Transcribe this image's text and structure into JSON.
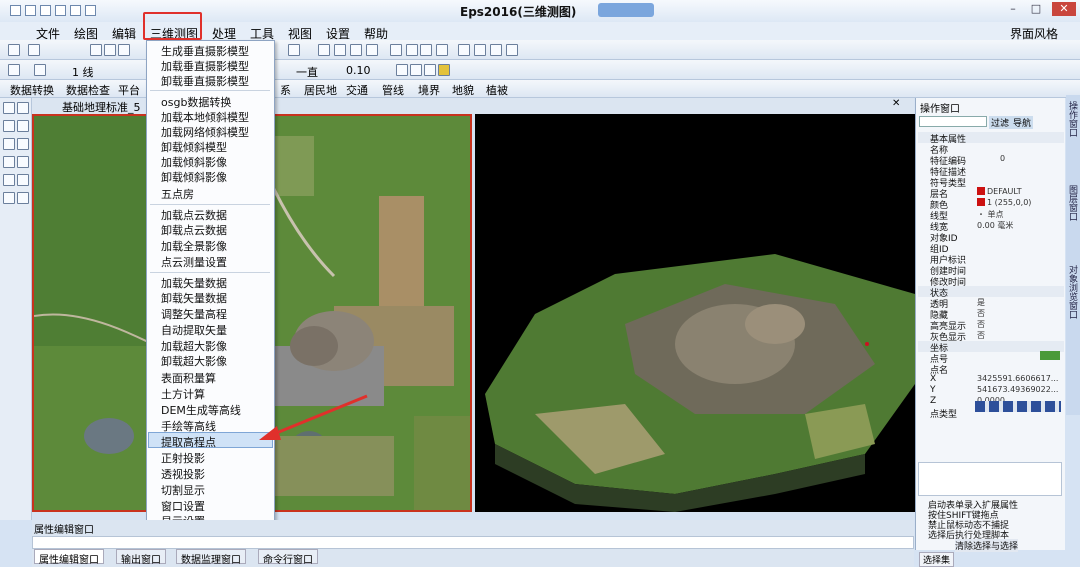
{
  "window": {
    "title": "Eps2016(三维测图)"
  },
  "menubar": {
    "items": [
      "文件",
      "绘图",
      "编辑",
      "三维测图",
      "处理",
      "工具",
      "视图",
      "设置",
      "帮助"
    ],
    "right": "界面风格"
  },
  "toolbar3": {
    "layer": "1 线",
    "width": "0.10",
    "zhi": "一直"
  },
  "toolbar4": {
    "items": [
      "数据转换",
      "数据检查",
      "平台",
      "系",
      "居民地",
      "交通",
      "管线",
      "境界",
      "地貌",
      "植被"
    ]
  },
  "doc_tab": "基础地理标准_5",
  "dropdown": {
    "items": [
      "生成垂直摄影模型",
      "加载垂直摄影模型",
      "卸载垂直摄影模型",
      "osgb数据转换",
      "加载本地倾斜模型",
      "加载网络倾斜模型",
      "卸载倾斜模型",
      "加载倾斜影像",
      "卸载倾斜影像",
      "五点房",
      "加载点云数据",
      "卸载点云数据",
      "加载全景影像",
      "点云测量设置",
      "加载矢量数据",
      "卸载矢量数据",
      "调整矢量高程",
      "自动提取矢量",
      "加载超大影像",
      "卸载超大影像",
      "表面积量算",
      "土方计算",
      "DEM生成等高线",
      "手绘等高线",
      "提取高程点",
      "正射投影",
      "透视投影",
      "切割显示",
      "窗口设置",
      "显示设置"
    ],
    "highlighted": "提取高程点"
  },
  "panel": {
    "title": "操作窗口",
    "buttons": [
      "过滤",
      "导航"
    ],
    "group1": "基本属性",
    "rows1": [
      [
        "名称",
        ""
      ],
      [
        "特征编码",
        "0"
      ],
      [
        "特征描述",
        ""
      ],
      [
        "符号类型",
        ""
      ],
      [
        "层名",
        "DEFAULT"
      ],
      [
        "颜色",
        "1 (255,0,0)"
      ],
      [
        "线型",
        "・ 单点"
      ],
      [
        "线宽",
        "0.00 毫米"
      ],
      [
        "对象ID",
        ""
      ],
      [
        "组ID",
        ""
      ],
      [
        "用户标识",
        ""
      ],
      [
        "创建时间",
        ""
      ],
      [
        "修改时间",
        ""
      ]
    ],
    "group2": "状态",
    "rows2": [
      [
        "透明",
        "是"
      ],
      [
        "隐藏",
        "否"
      ],
      [
        "高亮显示",
        "否"
      ],
      [
        "灰色显示",
        "否"
      ]
    ],
    "group3": "坐标",
    "rows3": [
      [
        "点号",
        ""
      ],
      [
        "点名",
        ""
      ],
      [
        "X",
        "3425591.6606617..."
      ],
      [
        "Y",
        "541673.49369022..."
      ],
      [
        "Z",
        "0.0000"
      ],
      [
        "点类型",
        ""
      ]
    ],
    "checks": [
      "启动表单录入扩展属性",
      "按住SHIFT键拖点",
      "禁止鼠标动态不捕捉",
      "选择后执行处理脚本"
    ],
    "footer": "清除选择与选择",
    "tab": "选择集",
    "side": [
      "操作窗口",
      "图层窗口",
      "对象浏览窗口"
    ]
  },
  "bottom": {
    "title": "属性编辑窗口",
    "tabs": [
      "属性编辑窗口",
      "输出窗口",
      "数据监理窗口",
      "命令行窗口"
    ]
  },
  "colors": {
    "accent": "#e0302b",
    "highlight": "#cfe2f7",
    "red_swatch": "#cc1111"
  }
}
